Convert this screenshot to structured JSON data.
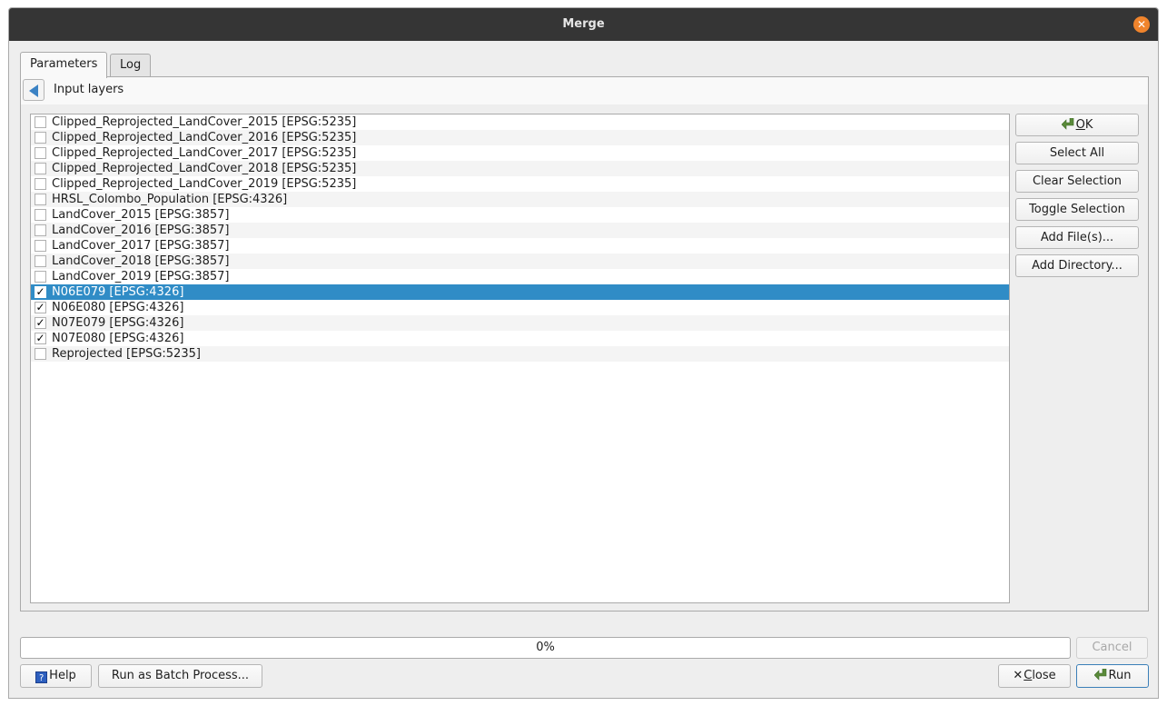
{
  "window": {
    "title": "Merge",
    "close_glyph": "✕"
  },
  "tabs": [
    {
      "label": "Parameters",
      "active": true
    },
    {
      "label": "Log",
      "active": false
    }
  ],
  "panel": {
    "title": "Input layers"
  },
  "layers": [
    {
      "label": "Clipped_Reprojected_LandCover_2015 [EPSG:5235]",
      "checked": false,
      "selected": false
    },
    {
      "label": "Clipped_Reprojected_LandCover_2016 [EPSG:5235]",
      "checked": false,
      "selected": false
    },
    {
      "label": "Clipped_Reprojected_LandCover_2017 [EPSG:5235]",
      "checked": false,
      "selected": false
    },
    {
      "label": "Clipped_Reprojected_LandCover_2018 [EPSG:5235]",
      "checked": false,
      "selected": false
    },
    {
      "label": "Clipped_Reprojected_LandCover_2019 [EPSG:5235]",
      "checked": false,
      "selected": false
    },
    {
      "label": "HRSL_Colombo_Population [EPSG:4326]",
      "checked": false,
      "selected": false
    },
    {
      "label": "LandCover_2015 [EPSG:3857]",
      "checked": false,
      "selected": false
    },
    {
      "label": "LandCover_2016 [EPSG:3857]",
      "checked": false,
      "selected": false
    },
    {
      "label": "LandCover_2017 [EPSG:3857]",
      "checked": false,
      "selected": false
    },
    {
      "label": "LandCover_2018 [EPSG:3857]",
      "checked": false,
      "selected": false
    },
    {
      "label": "LandCover_2019 [EPSG:3857]",
      "checked": false,
      "selected": false
    },
    {
      "label": "N06E079 [EPSG:4326]",
      "checked": true,
      "selected": true
    },
    {
      "label": "N06E080 [EPSG:4326]",
      "checked": true,
      "selected": false
    },
    {
      "label": "N07E079 [EPSG:4326]",
      "checked": true,
      "selected": false
    },
    {
      "label": "N07E080 [EPSG:4326]",
      "checked": true,
      "selected": false
    },
    {
      "label": "Reprojected [EPSG:5235]",
      "checked": false,
      "selected": false
    }
  ],
  "side_buttons": {
    "ok_mnemonic": "O",
    "ok_rest": "K",
    "select_all": "Select All",
    "clear_selection": "Clear Selection",
    "toggle_selection": "Toggle Selection",
    "add_files": "Add File(s)...",
    "add_directory": "Add Directory..."
  },
  "progress": {
    "value_percent": 0,
    "label": "0%"
  },
  "footer": {
    "cancel": "Cancel",
    "help": "Help",
    "help_icon_glyph": "?",
    "batch": "Run as Batch Process...",
    "close_mnemonic": "C",
    "close_rest": "lose",
    "run": "Run"
  },
  "colors": {
    "selection": "#308cc6",
    "titlebar": "#353535",
    "close_button": "#f0842c"
  }
}
